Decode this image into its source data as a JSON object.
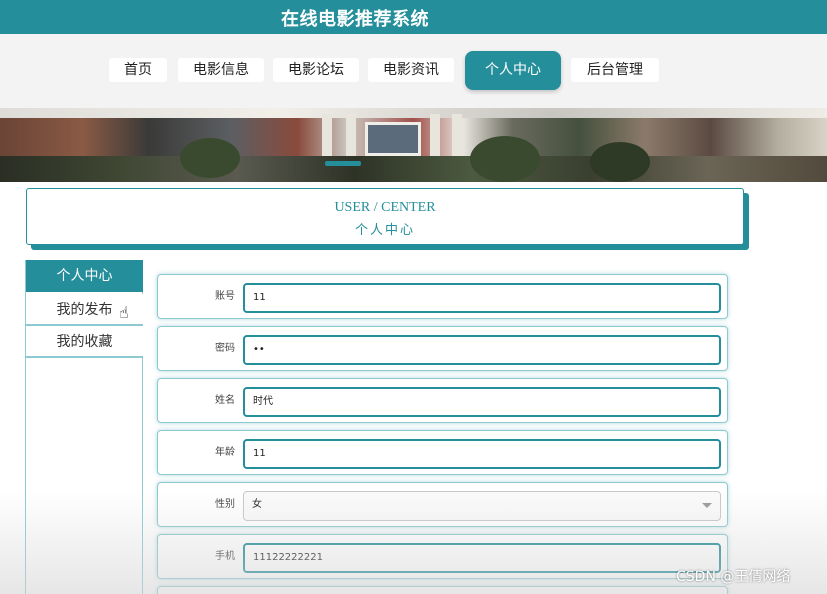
{
  "header": {
    "site_title": "在线电影推荐系统"
  },
  "nav": {
    "items": [
      {
        "label": "首页"
      },
      {
        "label": "电影信息"
      },
      {
        "label": "电影论坛"
      },
      {
        "label": "电影资讯"
      },
      {
        "label": "个人中心"
      },
      {
        "label": "后台管理"
      }
    ],
    "active": "个人中心"
  },
  "page_title": {
    "en": "USER / CENTER",
    "cn": "个人中心"
  },
  "sidebar": {
    "items": [
      {
        "label": "个人中心"
      },
      {
        "label": "我的发布"
      },
      {
        "label": "我的收藏"
      }
    ]
  },
  "form": {
    "fields": [
      {
        "label": "账号",
        "value": "11"
      },
      {
        "label": "密码",
        "value": "••"
      },
      {
        "label": "姓名",
        "value": "时代"
      },
      {
        "label": "年龄",
        "value": "11"
      },
      {
        "label": "性别",
        "value": "女"
      },
      {
        "label": "手机",
        "value": "11122222221"
      }
    ]
  },
  "watermark": "CSDN @王倩网络",
  "colors": {
    "accent": "#248e9b",
    "nav_bg": "#f3f3f3",
    "border": "#8cc9d0"
  }
}
